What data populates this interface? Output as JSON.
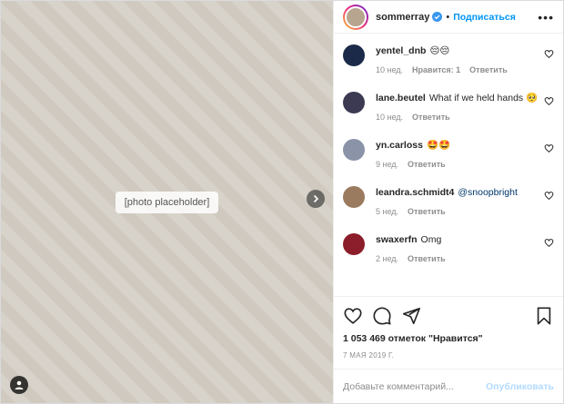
{
  "media": {
    "placeholder_note": "[photo placeholder]"
  },
  "header": {
    "username": "sommerray",
    "separator": "•",
    "follow_label": "Подписаться",
    "more_label": "•••"
  },
  "comments": [
    {
      "user": "yentel_dnb",
      "text": "😔😔",
      "time": "10 нед.",
      "likes": "Нравится: 1",
      "reply": "Ответить",
      "avatar_color": "#1b2a49"
    },
    {
      "user": "lane.beutel",
      "text": "What if we held hands 🥺",
      "time": "10 нед.",
      "likes": "",
      "reply": "Ответить",
      "avatar_color": "#3b3a52"
    },
    {
      "user": "yn.carloss",
      "text": "🤩🤩",
      "time": "9 нед.",
      "likes": "",
      "reply": "Ответить",
      "avatar_color": "#8a93a8"
    },
    {
      "user": "leandra.schmidt4",
      "text": "",
      "mention": "@snoopbright",
      "time": "5 нед.",
      "likes": "",
      "reply": "Ответить",
      "avatar_color": "#9a7b5f"
    },
    {
      "user": "swaxerfn",
      "text": "Omg",
      "time": "2 нед.",
      "likes": "",
      "reply": "Ответить",
      "avatar_color": "#8b1e2a"
    }
  ],
  "actions": {
    "likes_text": "1 053 469 отметок \"Нравится\"",
    "date": "7 МАЯ 2019 Г."
  },
  "add_comment": {
    "placeholder": "Добавьте комментарий...",
    "publish_label": "Опубликовать"
  },
  "colors": {
    "accent": "#0095f6",
    "verified": "#3897f0",
    "publish_disabled": "#b3dbff"
  }
}
